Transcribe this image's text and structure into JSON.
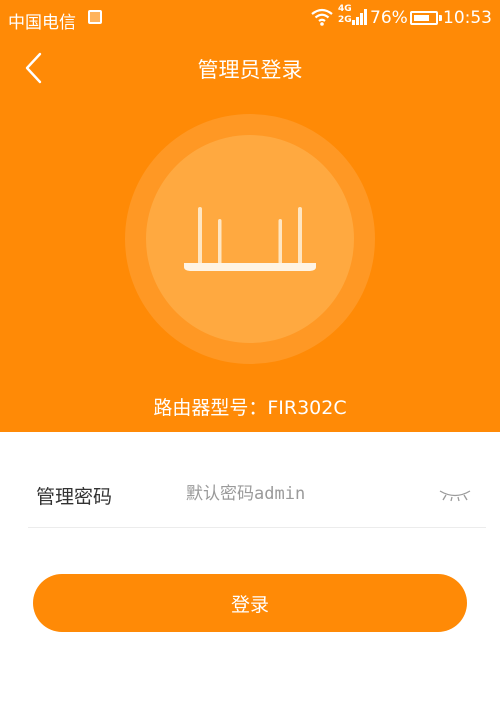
{
  "status_bar": {
    "carrier": "中国电信",
    "network_label_top": "4G",
    "network_label_bottom": "2G",
    "battery_percent": "76%",
    "battery_level": 0.76,
    "time": "10:53"
  },
  "header": {
    "title": "管理员登录",
    "back_icon": "chevron-left-icon"
  },
  "router": {
    "icon": "router-icon",
    "model_text": "路由器型号：FIR302C"
  },
  "form": {
    "password_label": "管理密码",
    "password_placeholder": "默认密码admin",
    "password_value": "",
    "visibility_icon": "eye-closed-icon"
  },
  "actions": {
    "login_label": "登录"
  },
  "colors": {
    "brand_orange": "#ff8a06",
    "circle_fill": "#ffa940",
    "text_dark": "#333333",
    "placeholder": "#9a9a9a"
  }
}
